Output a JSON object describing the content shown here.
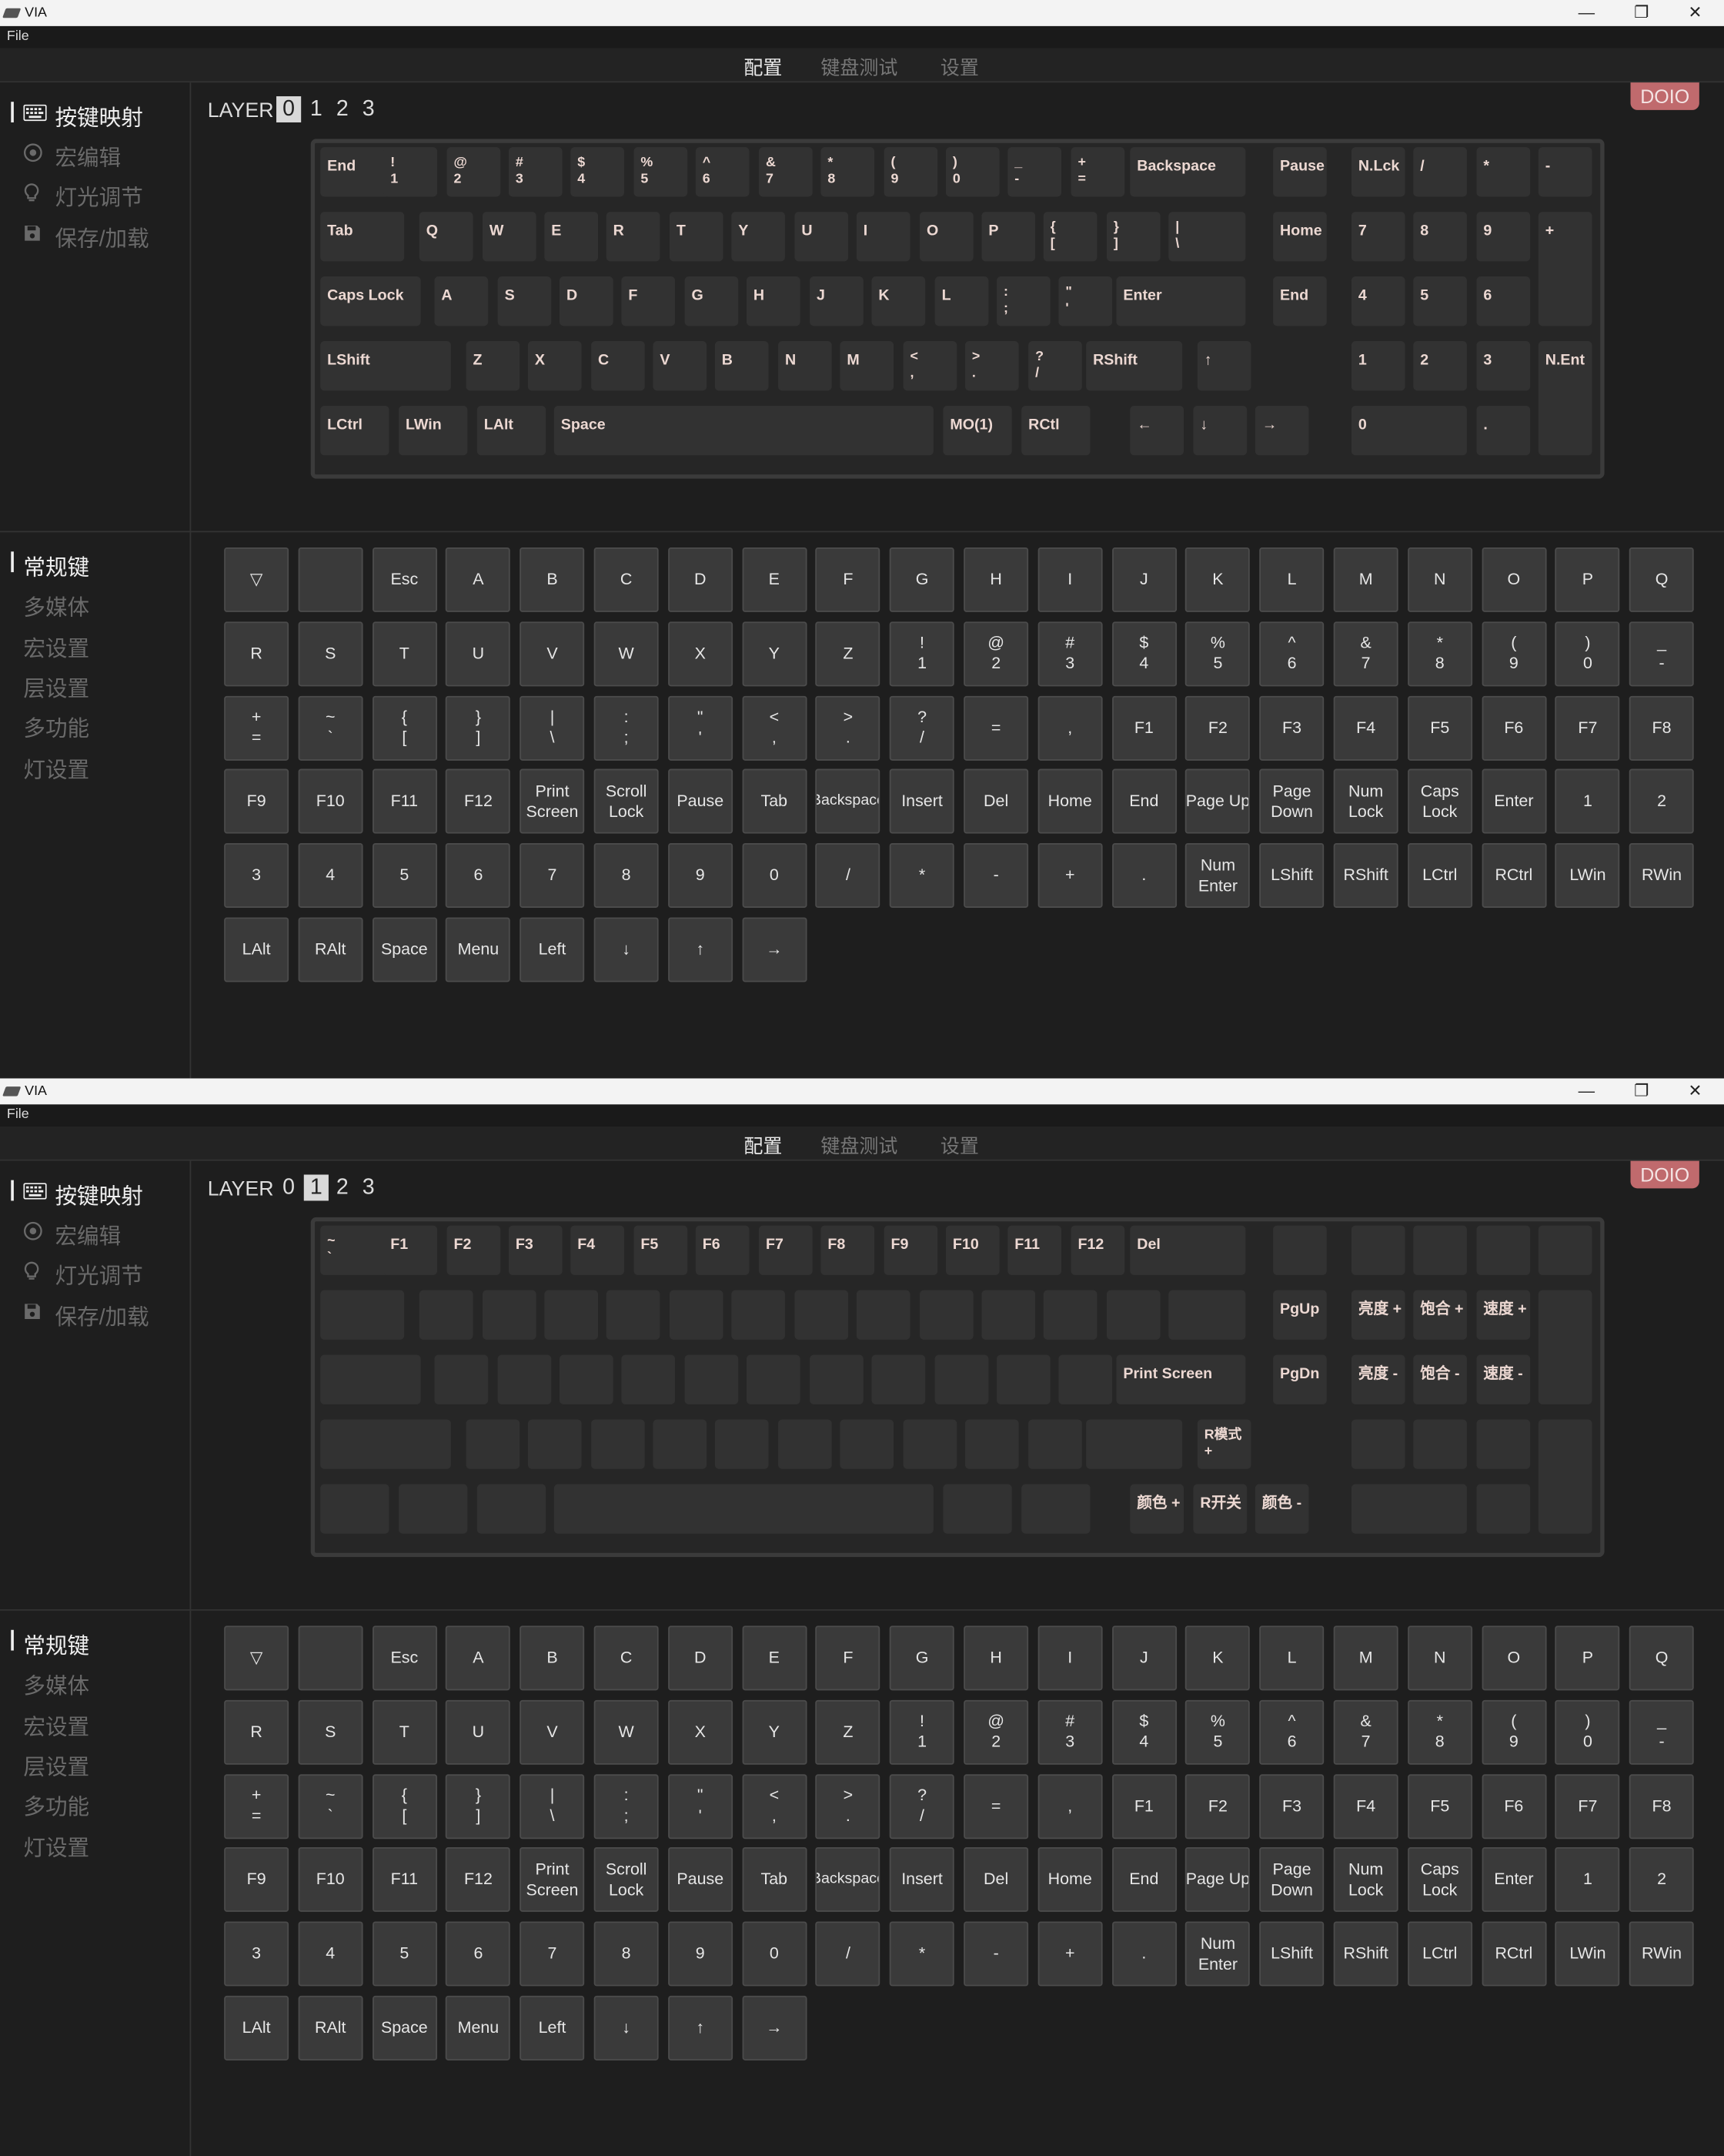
{
  "window": {
    "title": "VIA",
    "minimize_glyph": "—",
    "maximize_glyph": "❐",
    "close_glyph": "✕"
  },
  "menu": {
    "file": "File"
  },
  "nav": {
    "tabs": [
      "配置",
      "键盘测试",
      "设置"
    ],
    "active": 0
  },
  "sidebar_top": [
    {
      "label": "按键映射",
      "icon": "keyboard-icon",
      "active": true
    },
    {
      "label": "宏编辑",
      "icon": "target-icon",
      "active": false
    },
    {
      "label": "灯光调节",
      "icon": "lightbulb-icon",
      "active": false
    },
    {
      "label": "保存/加载",
      "icon": "save-icon",
      "active": false
    }
  ],
  "sidebar_bottom": [
    {
      "label": "常规键",
      "active": true
    },
    {
      "label": "多媒体",
      "active": false
    },
    {
      "label": "宏设置",
      "active": false
    },
    {
      "label": "层设置",
      "active": false
    },
    {
      "label": "多功能",
      "active": false
    },
    {
      "label": "灯设置",
      "active": false
    }
  ],
  "layer": {
    "label": "LAYER",
    "numbers": [
      "0",
      "1",
      "2",
      "3"
    ]
  },
  "brand": {
    "label": "DOIO",
    "color": "#c06a6d"
  },
  "keyboard_layer0": [
    "End",
    "!\n1",
    "@\n2",
    "#\n3",
    "$\n4",
    "%\n5",
    "^\n6",
    "&\n7",
    "*\n8",
    "(\n9",
    ")\n0",
    "_\n-",
    "+\n=",
    "Backspace",
    "Pause",
    "N.Lck",
    "/",
    "*",
    "-",
    "Tab",
    "Q",
    "W",
    "E",
    "R",
    "T",
    "Y",
    "U",
    "I",
    "O",
    "P",
    "{\n[",
    "}\n]",
    "|\n\\",
    "Home",
    "7",
    "8",
    "9",
    "+",
    "Caps Lock",
    "A",
    "S",
    "D",
    "F",
    "G",
    "H",
    "J",
    "K",
    "L",
    ":\n;",
    "\"\n'",
    "Enter",
    "End",
    "4",
    "5",
    "6",
    "LShift",
    "Z",
    "X",
    "C",
    "V",
    "B",
    "N",
    "M",
    "<\n,",
    ">\n.",
    "?\n/",
    "RShift",
    "↑",
    "1",
    "2",
    "3",
    "N.Ent",
    "LCtrl",
    "LWin",
    "LAlt",
    "Space",
    "MO(1)",
    "RCtl",
    "←",
    "↓",
    "→",
    "0",
    "."
  ],
  "keyboard_layer1": [
    "~\n`",
    "F1",
    "F2",
    "F3",
    "F4",
    "F5",
    "F6",
    "F7",
    "F8",
    "F9",
    "F10",
    "F11",
    "F12",
    "Del",
    "",
    "",
    "",
    "",
    "",
    "",
    "",
    "",
    "",
    "",
    "",
    "",
    "",
    "",
    "",
    "",
    "",
    "",
    "",
    "PgUp",
    "亮度 +",
    "饱合 +",
    "速度 +",
    "",
    "",
    "",
    "",
    "",
    "",
    "",
    "",
    "",
    "",
    "",
    "",
    "",
    "Print Screen",
    "PgDn",
    "亮度 -",
    "饱合 -",
    "速度 -",
    "",
    "",
    "",
    "",
    "",
    "",
    "",
    "",
    "",
    "",
    "",
    "",
    "R模式\n+",
    "",
    "",
    "",
    "",
    "",
    "",
    "",
    "",
    "",
    "",
    "颜色 +",
    "R开关",
    "颜色 -",
    "",
    ""
  ],
  "palette": [
    "▽",
    "",
    "Esc",
    "A",
    "B",
    "C",
    "D",
    "E",
    "F",
    "G",
    "H",
    "I",
    "J",
    "K",
    "L",
    "M",
    "N",
    "O",
    "P",
    "Q",
    "R",
    "S",
    "T",
    "U",
    "V",
    "W",
    "X",
    "Y",
    "Z",
    "!\n1",
    "@\n2",
    "#\n3",
    "$\n4",
    "%\n5",
    "^\n6",
    "&\n7",
    "*\n8",
    "(\n9",
    ")\n0",
    "_\n-",
    "+\n=",
    "~\n`",
    "{\n[",
    "}\n]",
    "|\n\\",
    ":\n;",
    "\"\n'",
    "<\n,",
    ">\n.",
    "?\n/",
    "=",
    ",",
    "F1",
    "F2",
    "F3",
    "F4",
    "F5",
    "F6",
    "F7",
    "F8",
    "F9",
    "F10",
    "F11",
    "F12",
    "Print\nScreen",
    "Scroll\nLock",
    "Pause",
    "Tab",
    "Backspace",
    "Insert",
    "Del",
    "Home",
    "End",
    "Page Up",
    "Page\nDown",
    "Num\nLock",
    "Caps\nLock",
    "Enter",
    "1",
    "2",
    "3",
    "4",
    "5",
    "6",
    "7",
    "8",
    "9",
    "0",
    "/",
    "*",
    "-",
    "+",
    ".",
    "Num\nEnter",
    "LShift",
    "RShift",
    "LCtrl",
    "RCtrl",
    "LWin",
    "RWin",
    "LAlt",
    "RAlt",
    "Space",
    "Menu",
    "Left",
    "↓",
    "↑",
    "→"
  ],
  "colors": {
    "background": "#1e1e1e",
    "key": "#323232",
    "key_text": "#ecd8d2",
    "palette_key": "#3a3a3a"
  }
}
